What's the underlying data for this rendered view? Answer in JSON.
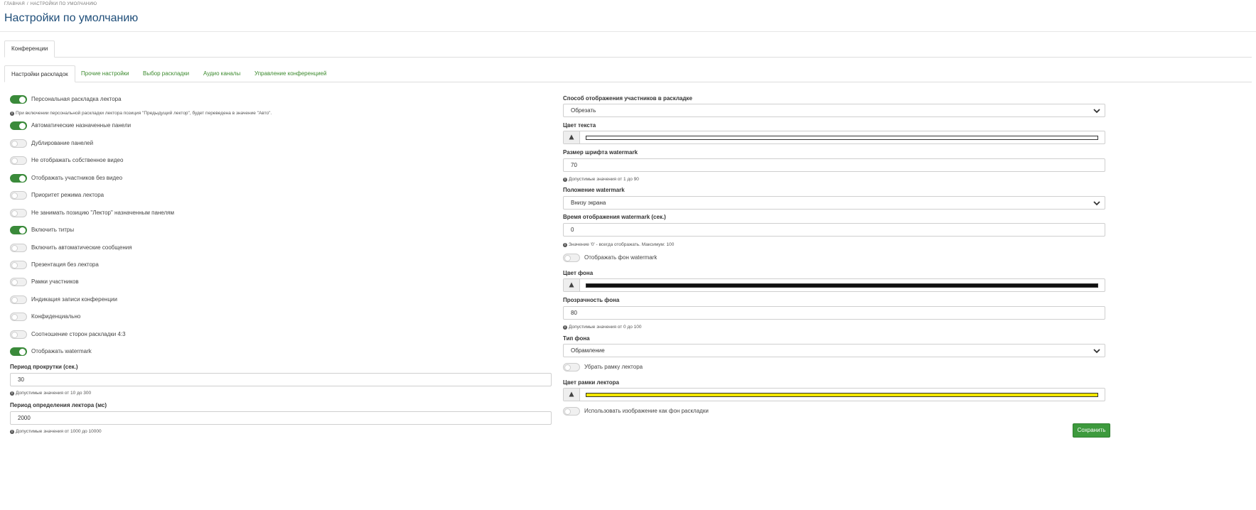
{
  "breadcrumb": {
    "home": "ГЛАВНАЯ",
    "separator": "/",
    "current": "НАСТРОЙКИ ПО УМОЛЧАНИЮ"
  },
  "page_title": "Настройки по умолчанию",
  "top_tabs": [
    {
      "label": "Конференции",
      "active": true
    }
  ],
  "sub_tabs": [
    {
      "label": "Настройки раскладок",
      "active": true
    },
    {
      "label": "Прочие настройки",
      "active": false
    },
    {
      "label": "Выбор раскладки",
      "active": false
    },
    {
      "label": "Аудио каналы",
      "active": false
    },
    {
      "label": "Управление конференцией",
      "active": false
    }
  ],
  "left": {
    "toggles": [
      {
        "label": "Персональная раскладка лектора",
        "on": true
      },
      {
        "label": "Автоматические назначенные панели",
        "on": true
      },
      {
        "label": "Дублирование панелей",
        "on": false
      },
      {
        "label": "Не отображать собственное видео",
        "on": false
      },
      {
        "label": "Отображать участников без видео",
        "on": true
      },
      {
        "label": "Приоритет режима лектора",
        "on": false
      },
      {
        "label": "Не занимать позицию \"Лектор\" назначенным панелям",
        "on": false
      },
      {
        "label": "Включить титры",
        "on": true
      },
      {
        "label": "Включить автоматические сообщения",
        "on": false
      },
      {
        "label": "Презентация без лектора",
        "on": false
      },
      {
        "label": "Рамки участников",
        "on": false
      },
      {
        "label": "Индикация записи конференции",
        "on": false
      },
      {
        "label": "Конфиденциально",
        "on": false
      },
      {
        "label": "Соотношение сторон раскладки 4:3",
        "on": false
      },
      {
        "label": "Отображать watermark",
        "on": true
      }
    ],
    "personal_layout_note": "При включении персональной раскладки лектора позиция \"Предыдущий лектор\", будет переведена в значение \"Авто\".",
    "scroll_period": {
      "label": "Период прокрутки (сек.)",
      "value": "30",
      "hint": "Допустимые значения от 10 до 300"
    },
    "speaker_period": {
      "label": "Период определения лектора (мс)",
      "value": "2000",
      "hint": "Допустимые значения от 1000 до 10000"
    }
  },
  "right": {
    "display_mode": {
      "label": "Способ отображения участников в раскладке",
      "value": "Обрезать"
    },
    "text_color": {
      "label": "Цвет текста",
      "color": "#ffffff"
    },
    "font_size": {
      "label": "Размер шрифта watermark",
      "value": "70",
      "hint": "Допустимые значения от 1 до 90"
    },
    "position": {
      "label": "Положение watermark",
      "value": "Внизу экрана"
    },
    "display_time": {
      "label": "Время отображения watermark (сек.)",
      "value": "0",
      "hint": "Значение '0' - всегда отображать. Максимум: 100"
    },
    "show_bg_toggle": {
      "label": "Отображать фон watermark",
      "on": false
    },
    "bg_color": {
      "label": "Цвет фона",
      "color": "#111111"
    },
    "bg_opacity": {
      "label": "Прозрачность фона",
      "value": "80",
      "hint": "Допустимые значения от 0 до 100"
    },
    "bg_type": {
      "label": "Тип фона",
      "value": "Обрамление"
    },
    "remove_frame_toggle": {
      "label": "Убрать рамку лектора",
      "on": false
    },
    "frame_color": {
      "label": "Цвет рамки лектора",
      "color": "#f2e600"
    },
    "use_image_toggle": {
      "label": "Использовать изображение как фон раскладки",
      "on": false
    }
  },
  "save_label": "Сохранить",
  "accent_color": "#3a8a3a",
  "link_color": "#3c8a2e"
}
